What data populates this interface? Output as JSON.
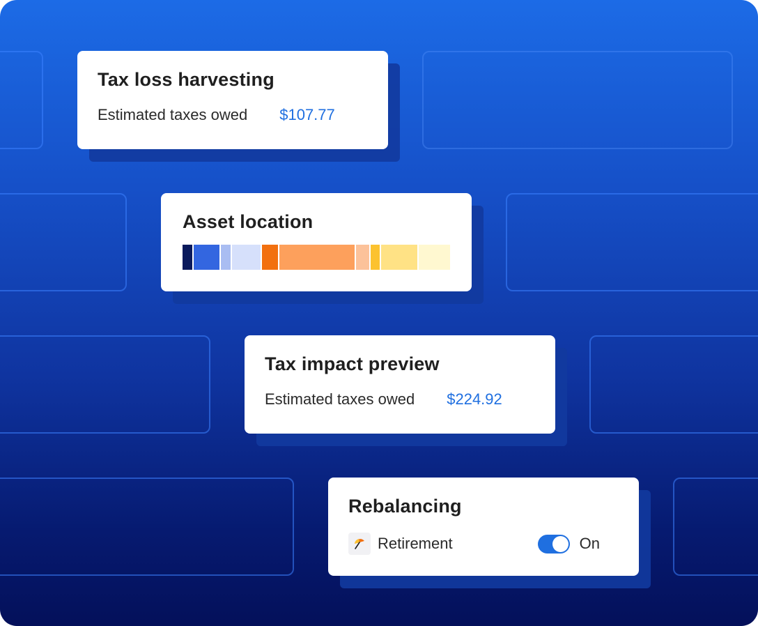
{
  "colors": {
    "accent": "#1f6fe0",
    "background_top": "#1c6be6",
    "background_bottom": "#04105a"
  },
  "cards": {
    "tax_loss": {
      "title": "Tax loss harvesting",
      "label": "Estimated taxes owed",
      "amount": "$107.77"
    },
    "asset_location": {
      "title": "Asset location",
      "segments": [
        {
          "color": "#0a1a5c",
          "share": 0.037
        },
        {
          "color": "#3366e0",
          "share": 0.1
        },
        {
          "color": "#a9bdf2",
          "share": 0.037
        },
        {
          "color": "#d6e0fb",
          "share": 0.11
        },
        {
          "color": "#f2700f",
          "share": 0.06
        },
        {
          "color": "#fda05c",
          "share": 0.29
        },
        {
          "color": "#fcc29a",
          "share": 0.05
        },
        {
          "color": "#fcc22f",
          "share": 0.035
        },
        {
          "color": "#ffe285",
          "share": 0.14
        },
        {
          "color": "#fff8d0",
          "share": 0.12
        }
      ]
    },
    "tax_impact": {
      "title": "Tax impact preview",
      "label": "Estimated taxes owed",
      "amount": "$224.92"
    },
    "rebalancing": {
      "title": "Rebalancing",
      "account_icon": "umbrella-icon",
      "account_label": "Retirement",
      "toggle_state": "On"
    }
  }
}
